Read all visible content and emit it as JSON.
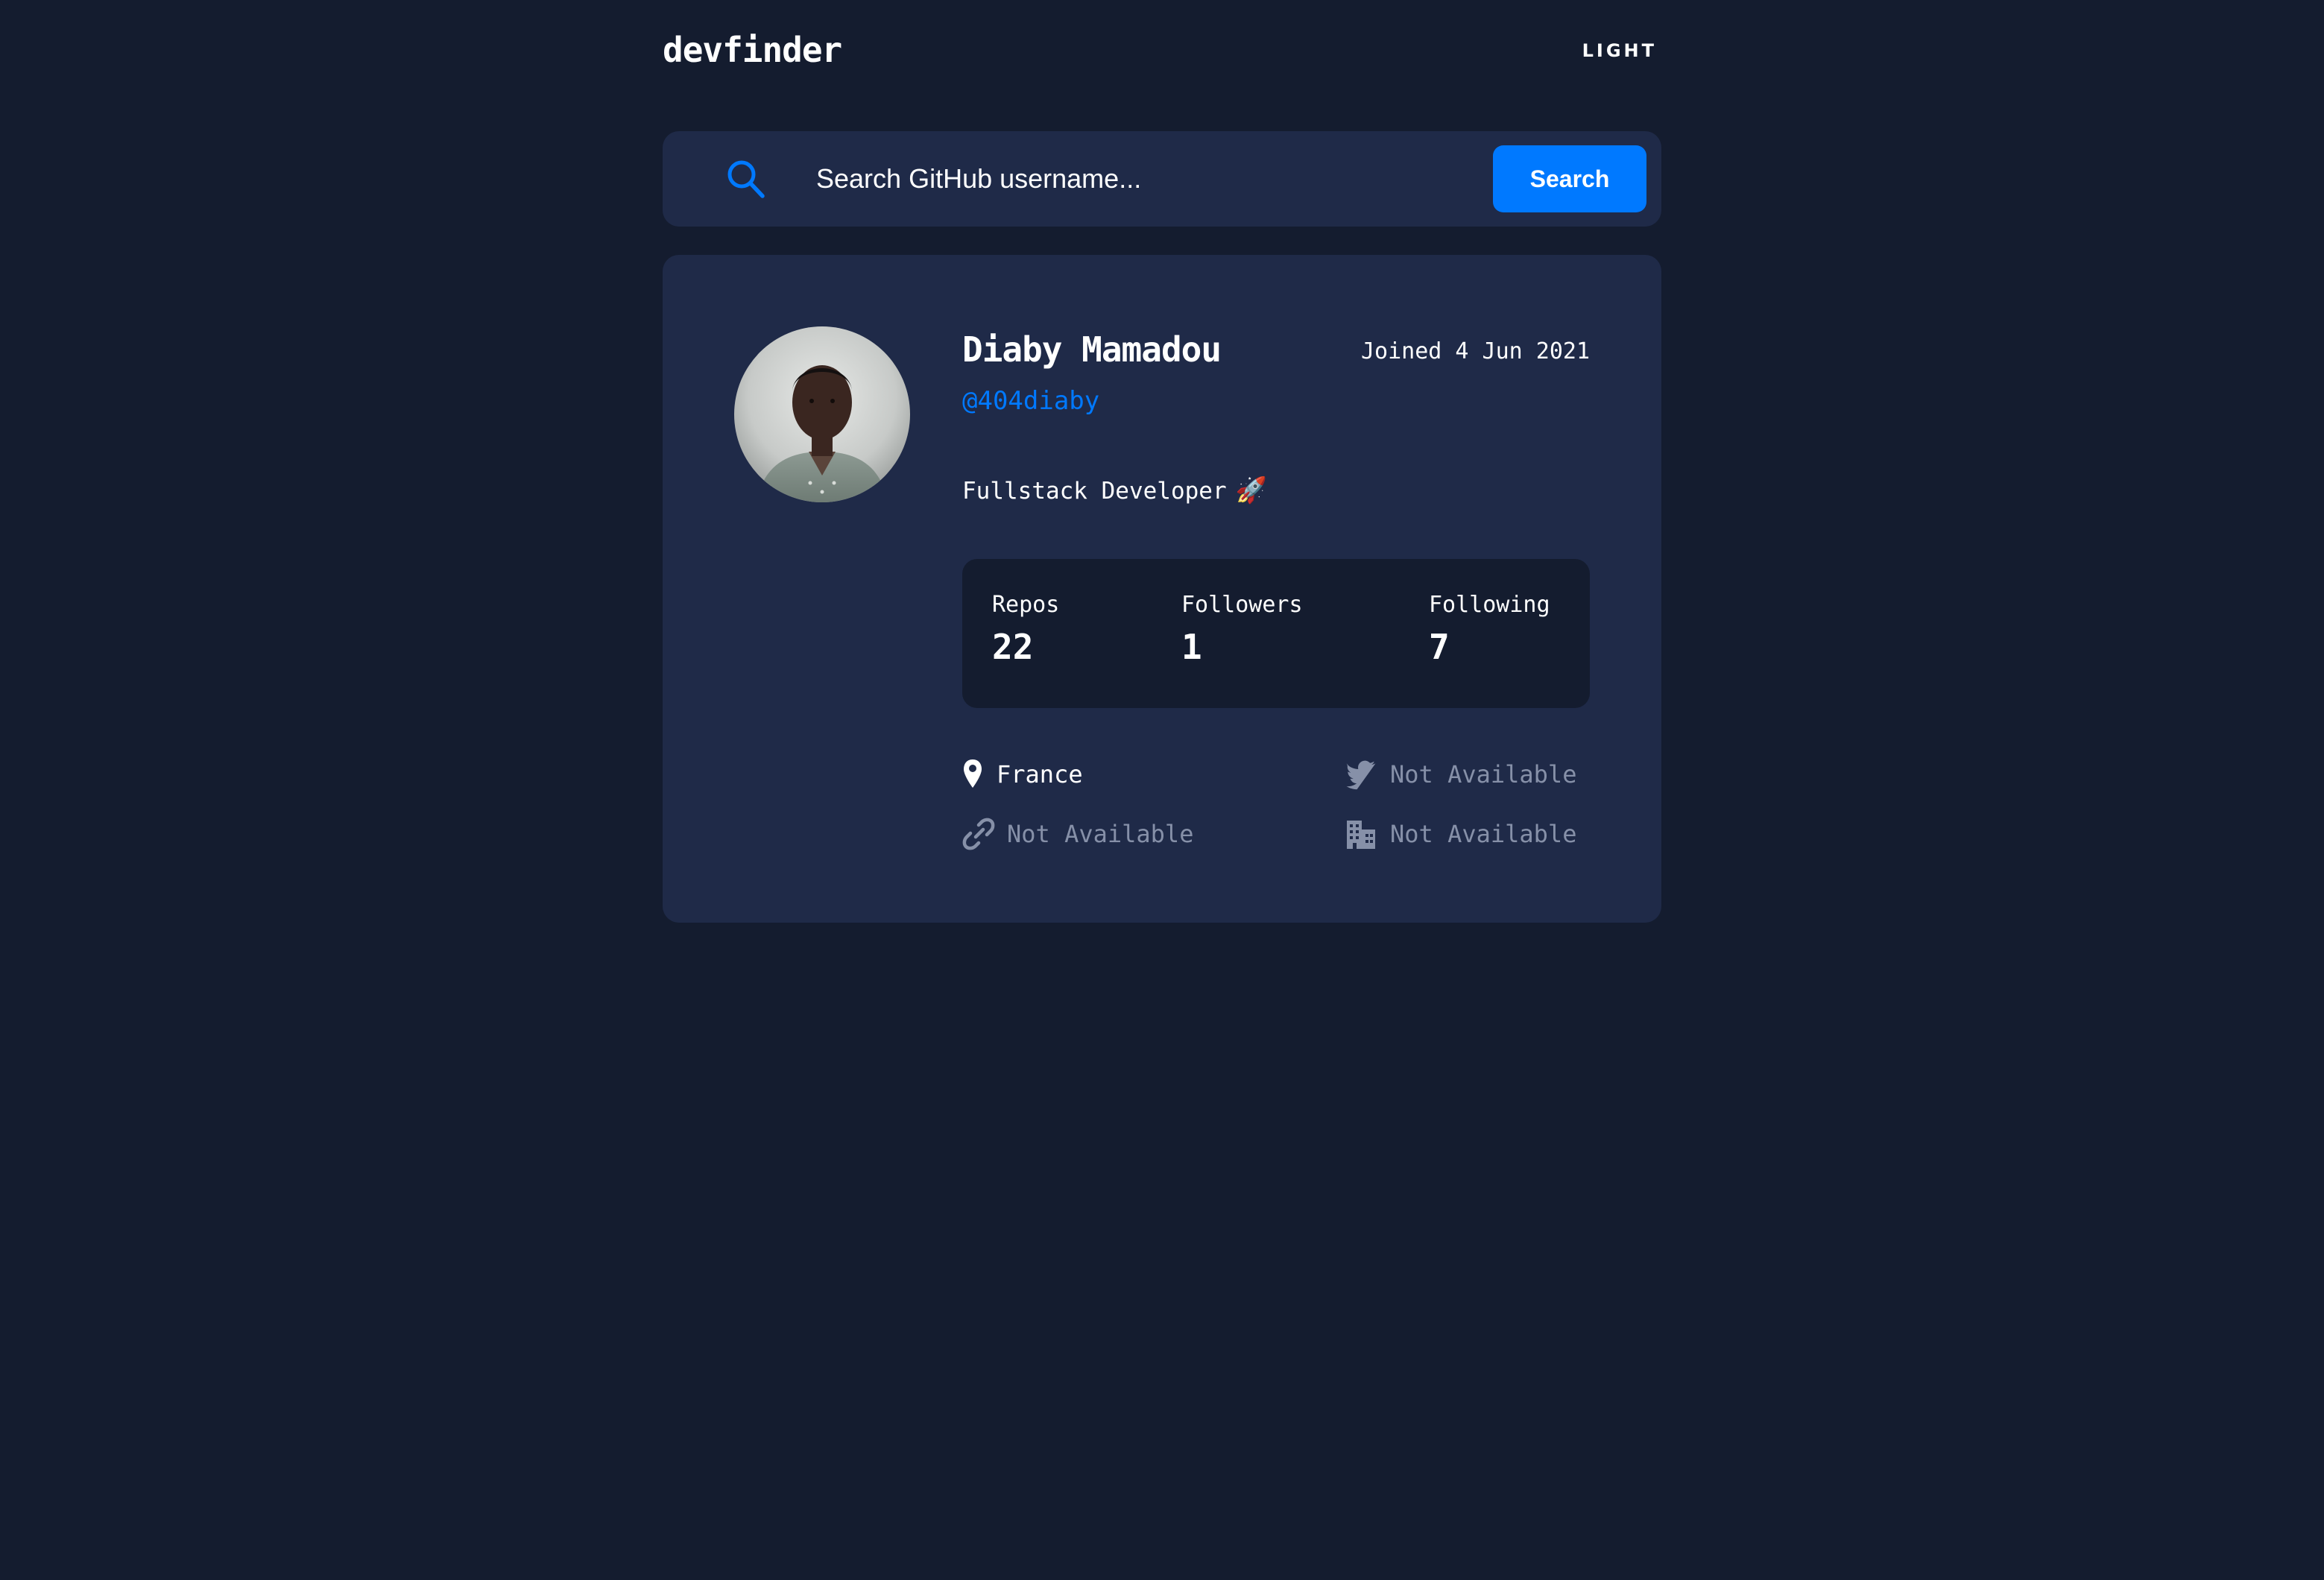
{
  "header": {
    "logo": "devfinder",
    "theme_toggle": "LIGHT"
  },
  "search": {
    "placeholder": "Search GitHub username...",
    "button_label": "Search",
    "icon": "search-icon"
  },
  "profile": {
    "name": "Diaby Mamadou",
    "login": "@404diaby",
    "joined": "Joined 4 Jun 2021",
    "bio": "Fullstack Developer",
    "bio_emoji": "🚀",
    "stats": {
      "repos_label": "Repos",
      "repos_value": "22",
      "followers_label": "Followers",
      "followers_value": "1",
      "following_label": "Following",
      "following_value": "7"
    },
    "links": {
      "location": "France",
      "blog": "Not Available",
      "twitter": "Not Available",
      "company": "Not Available"
    }
  },
  "colors": {
    "background": "#141c2f",
    "card": "#1f2a48",
    "accent": "#0079ff",
    "muted": "#8690a8"
  }
}
